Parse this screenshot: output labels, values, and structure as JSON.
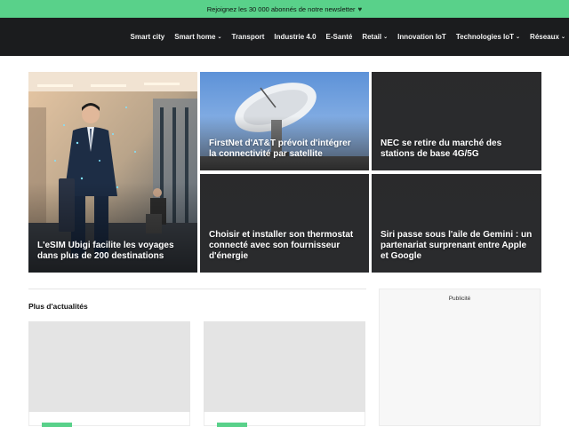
{
  "banner": {
    "text": "Rejoignez les 30 000 abonnés de notre newsletter",
    "icon": "heart-icon"
  },
  "nav": {
    "items": [
      {
        "label": "Smart city",
        "dropdown": false
      },
      {
        "label": "Smart home",
        "dropdown": true
      },
      {
        "label": "Transport",
        "dropdown": false
      },
      {
        "label": "Industrie 4.0",
        "dropdown": false
      },
      {
        "label": "E-Santé",
        "dropdown": false
      },
      {
        "label": "Retail",
        "dropdown": true
      },
      {
        "label": "Innovation IoT",
        "dropdown": false
      },
      {
        "label": "Technologies IoT",
        "dropdown": true
      },
      {
        "label": "Réseaux",
        "dropdown": true
      }
    ]
  },
  "featured": {
    "main": {
      "title": "L'eSIM Ubigi facilite les voyages dans plus de 200 destinations"
    },
    "cards": [
      {
        "title": "FirstNet d'AT&T prévoit d'intégrer la connectivité par satellite"
      },
      {
        "title": "NEC se retire du marché des stations de base 4G/5G"
      },
      {
        "title": "Choisir et installer son thermostat connecté avec son fournisseur d'énergie"
      },
      {
        "title": "Siri passe sous l'aile de Gemini : un partenariat surprenant entre Apple et Google"
      }
    ]
  },
  "more_news": {
    "title": "Plus d'actualités"
  },
  "ad": {
    "label": "Publicité"
  },
  "colors": {
    "accent": "#59d18a",
    "nav_bg": "#1b1c1e",
    "card_bg": "#2a2b2d"
  }
}
